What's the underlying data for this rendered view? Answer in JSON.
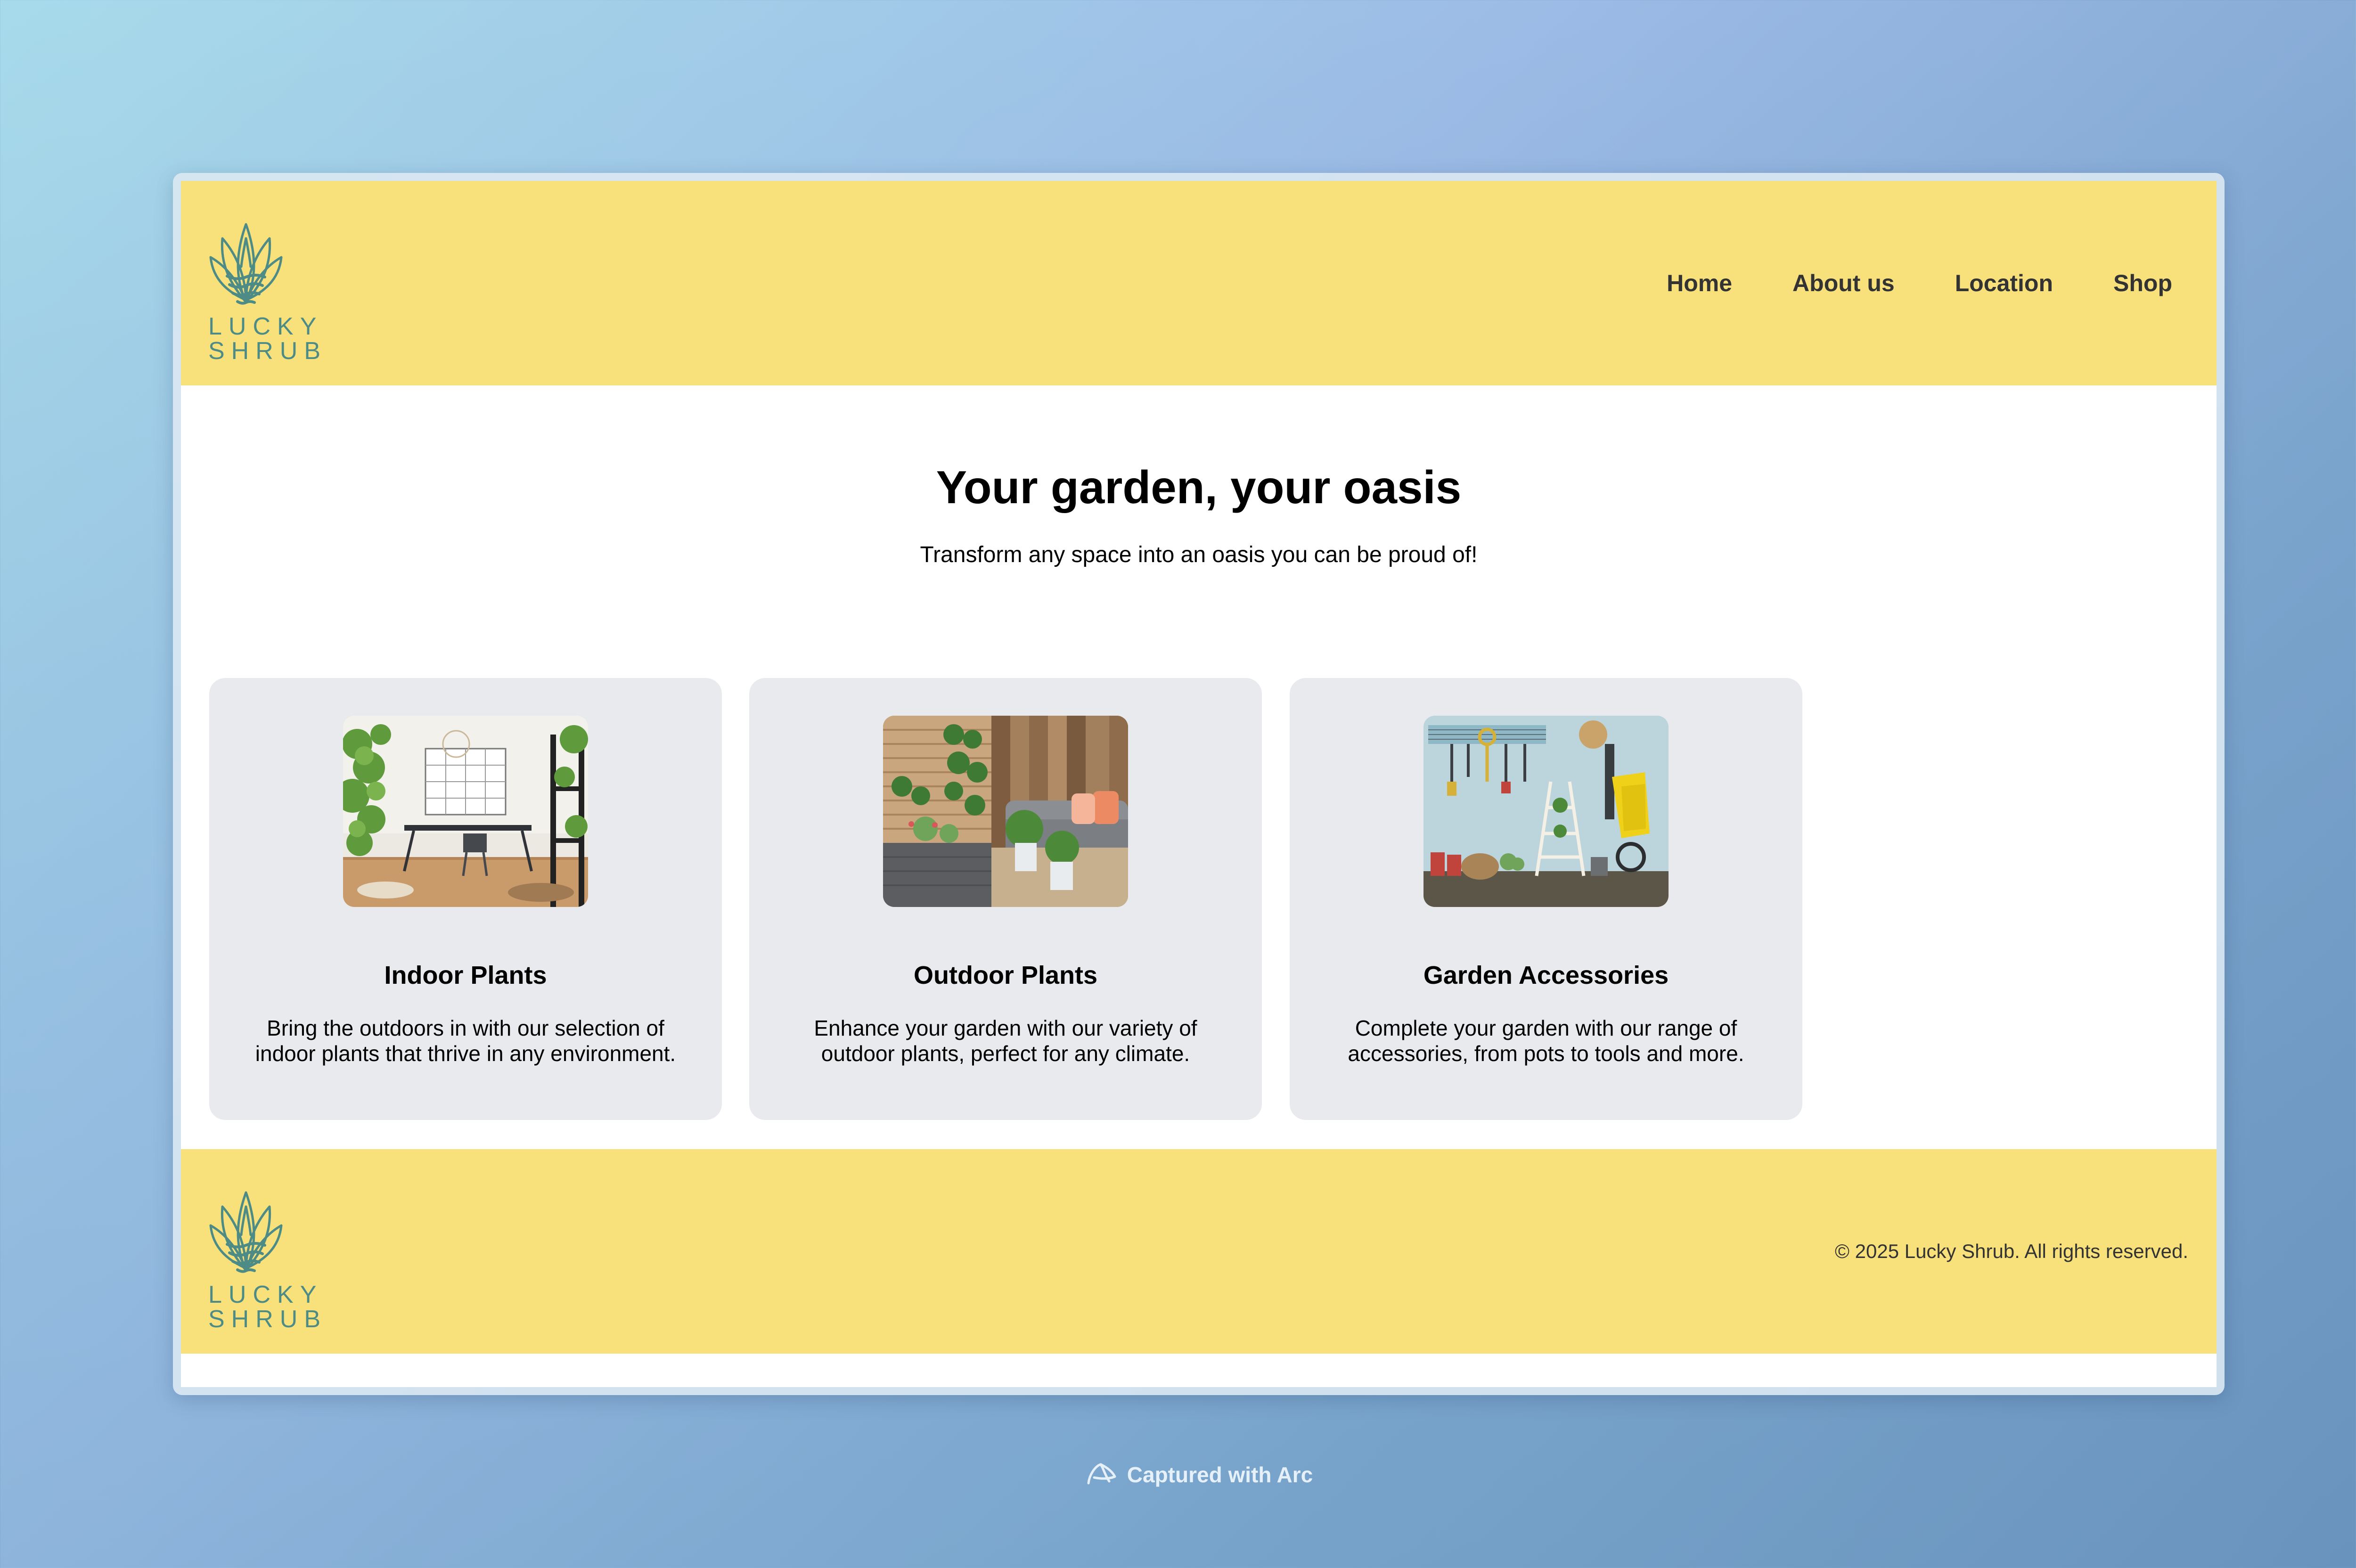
{
  "brand": {
    "name_line1": "LUCKY",
    "name_line2": "SHRUB",
    "color": "#4d8c86",
    "header_bg": "#f8e17b"
  },
  "nav": {
    "items": [
      {
        "label": "Home"
      },
      {
        "label": "About us"
      },
      {
        "label": "Location"
      },
      {
        "label": "Shop"
      }
    ]
  },
  "hero": {
    "title": "Your garden, your oasis",
    "subtitle": "Transform any space into an oasis you can be proud of!"
  },
  "cards": [
    {
      "title": "Indoor Plants",
      "description": "Bring the outdoors in with our selection of indoor plants that thrive in any environment.",
      "image": "indoor-room-with-plants-image"
    },
    {
      "title": "Outdoor Plants",
      "description": "Enhance your garden with our variety of outdoor plants, perfect for any climate.",
      "image": "patio-with-plants-image"
    },
    {
      "title": "Garden Accessories",
      "description": "Complete your garden with our range of accessories, from pots to tools and more.",
      "image": "garden-tools-wall-image"
    }
  ],
  "footer": {
    "copyright": "© 2025 Lucky Shrub. All rights reserved."
  },
  "capture": {
    "label": "Captured with Arc"
  }
}
